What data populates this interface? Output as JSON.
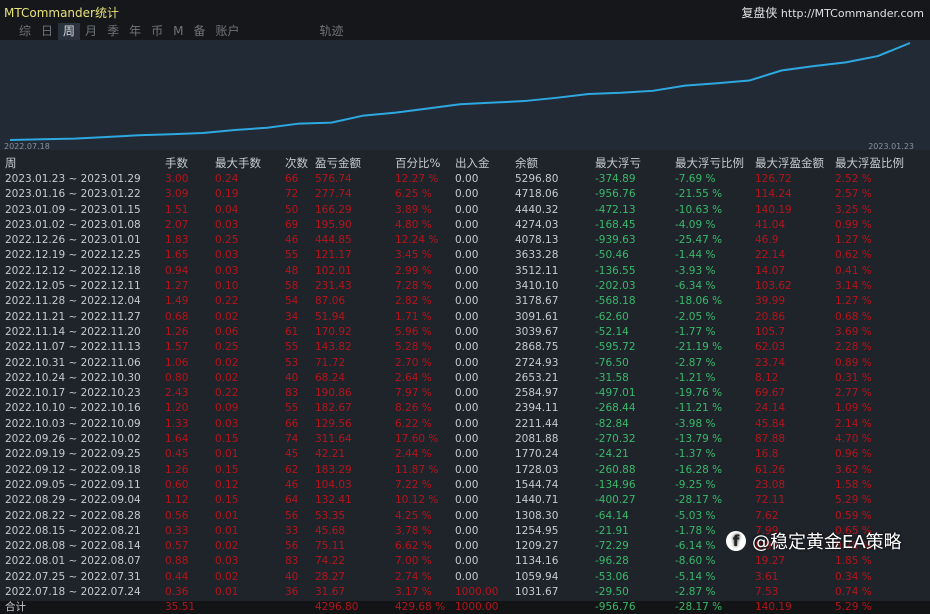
{
  "app": {
    "title": "MTCommander统计",
    "site_name": "复盘侠",
    "site_url": "http://MTCommander.com"
  },
  "tabs": [
    "综",
    "日",
    "周",
    "月",
    "季",
    "年",
    "币",
    "M",
    "备",
    "账户",
    "轨迹"
  ],
  "active_tab": "周",
  "chart": {
    "start_label": "2022.07.18",
    "end_label": "2023.01.23",
    "line_color": "#2ea8e0"
  },
  "columns": [
    "周",
    "手数",
    "最大手数",
    "次数",
    "盈亏金额",
    "百分比%",
    "出入金",
    "余额",
    "最大浮亏",
    "最大浮亏比例",
    "最大浮盈金额",
    "最大浮盈比例"
  ],
  "rows": [
    [
      "2023.01.23 ~ 2023.01.29",
      "3.00",
      "0.24",
      "66",
      "576.74",
      "12.27 %",
      "0.00",
      "5296.80",
      "-374.89",
      "-7.69 %",
      "126.72",
      "2.52 %"
    ],
    [
      "2023.01.16 ~ 2023.01.22",
      "3.09",
      "0.19",
      "72",
      "277.74",
      "6.25 %",
      "0.00",
      "4718.06",
      "-956.76",
      "-21.55 %",
      "114.24",
      "2.57 %"
    ],
    [
      "2023.01.09 ~ 2023.01.15",
      "1.51",
      "0.04",
      "50",
      "166.29",
      "3.89 %",
      "0.00",
      "4440.32",
      "-472.13",
      "-10.63 %",
      "140.19",
      "3.25 %"
    ],
    [
      "2023.01.02 ~ 2023.01.08",
      "2.07",
      "0.03",
      "69",
      "195.90",
      "4.80 %",
      "0.00",
      "4274.03",
      "-168.45",
      "-4.09 %",
      "41.04",
      "0.99 %"
    ],
    [
      "2022.12.26 ~ 2023.01.01",
      "1.83",
      "0.25",
      "46",
      "444.85",
      "12.24 %",
      "0.00",
      "4078.13",
      "-939.63",
      "-25.47 %",
      "46.9",
      "1.27 %"
    ],
    [
      "2022.12.19 ~ 2022.12.25",
      "1.65",
      "0.03",
      "55",
      "121.17",
      "3.45 %",
      "0.00",
      "3633.28",
      "-50.46",
      "-1.44 %",
      "22.14",
      "0.62 %"
    ],
    [
      "2022.12.12 ~ 2022.12.18",
      "0.94",
      "0.03",
      "48",
      "102.01",
      "2.99 %",
      "0.00",
      "3512.11",
      "-136.55",
      "-3.93 %",
      "14.07",
      "0.41 %"
    ],
    [
      "2022.12.05 ~ 2022.12.11",
      "1.27",
      "0.10",
      "58",
      "231.43",
      "7.28 %",
      "0.00",
      "3410.10",
      "-202.03",
      "-6.34 %",
      "103.62",
      "3.14 %"
    ],
    [
      "2022.11.28 ~ 2022.12.04",
      "1.49",
      "0.22",
      "54",
      "87.06",
      "2.82 %",
      "0.00",
      "3178.67",
      "-568.18",
      "-18.06 %",
      "39.99",
      "1.27 %"
    ],
    [
      "2022.11.21 ~ 2022.11.27",
      "0.68",
      "0.02",
      "34",
      "51.94",
      "1.71 %",
      "0.00",
      "3091.61",
      "-62.60",
      "-2.05 %",
      "20.86",
      "0.68 %"
    ],
    [
      "2022.11.14 ~ 2022.11.20",
      "1.26",
      "0.06",
      "61",
      "170.92",
      "5.96 %",
      "0.00",
      "3039.67",
      "-52.14",
      "-1.77 %",
      "105.7",
      "3.69 %"
    ],
    [
      "2022.11.07 ~ 2022.11.13",
      "1.57",
      "0.25",
      "55",
      "143.82",
      "5.28 %",
      "0.00",
      "2868.75",
      "-595.72",
      "-21.19 %",
      "62.03",
      "2.28 %"
    ],
    [
      "2022.10.31 ~ 2022.11.06",
      "1.06",
      "0.02",
      "53",
      "71.72",
      "2.70 %",
      "0.00",
      "2724.93",
      "-76.50",
      "-2.87 %",
      "23.74",
      "0.89 %"
    ],
    [
      "2022.10.24 ~ 2022.10.30",
      "0.80",
      "0.02",
      "40",
      "68.24",
      "2.64 %",
      "0.00",
      "2653.21",
      "-31.58",
      "-1.21 %",
      "8.12",
      "0.31 %"
    ],
    [
      "2022.10.17 ~ 2022.10.23",
      "2.43",
      "0.22",
      "83",
      "190.86",
      "7.97 %",
      "0.00",
      "2584.97",
      "-497.01",
      "-19.76 %",
      "69.67",
      "2.77 %"
    ],
    [
      "2022.10.10 ~ 2022.10.16",
      "1.20",
      "0.09",
      "55",
      "182.67",
      "8.26 %",
      "0.00",
      "2394.11",
      "-268.44",
      "-11.21 %",
      "24.14",
      "1.09 %"
    ],
    [
      "2022.10.03 ~ 2022.10.09",
      "1.33",
      "0.03",
      "66",
      "129.56",
      "6.22 %",
      "0.00",
      "2211.44",
      "-82.84",
      "-3.98 %",
      "45.84",
      "2.14 %"
    ],
    [
      "2022.09.26 ~ 2022.10.02",
      "1.64",
      "0.15",
      "74",
      "311.64",
      "17.60 %",
      "0.00",
      "2081.88",
      "-270.32",
      "-13.79 %",
      "87.88",
      "4.70 %"
    ],
    [
      "2022.09.19 ~ 2022.09.25",
      "0.45",
      "0.01",
      "45",
      "42.21",
      "2.44 %",
      "0.00",
      "1770.24",
      "-24.21",
      "-1.37 %",
      "16.8",
      "0.96 %"
    ],
    [
      "2022.09.12 ~ 2022.09.18",
      "1.26",
      "0.15",
      "62",
      "183.29",
      "11.87 %",
      "0.00",
      "1728.03",
      "-260.88",
      "-16.28 %",
      "61.26",
      "3.62 %"
    ],
    [
      "2022.09.05 ~ 2022.09.11",
      "0.60",
      "0.12",
      "46",
      "104.03",
      "7.22 %",
      "0.00",
      "1544.74",
      "-134.96",
      "-9.25 %",
      "23.08",
      "1.58 %"
    ],
    [
      "2022.08.29 ~ 2022.09.04",
      "1.12",
      "0.15",
      "64",
      "132.41",
      "10.12 %",
      "0.00",
      "1440.71",
      "-400.27",
      "-28.17 %",
      "72.11",
      "5.29 %"
    ],
    [
      "2022.08.22 ~ 2022.08.28",
      "0.56",
      "0.01",
      "56",
      "53.35",
      "4.25 %",
      "0.00",
      "1308.30",
      "-64.14",
      "-5.03 %",
      "7.62",
      "0.59 %"
    ],
    [
      "2022.08.15 ~ 2022.08.21",
      "0.33",
      "0.01",
      "33",
      "45.68",
      "3.78 %",
      "0.00",
      "1254.95",
      "-21.91",
      "-1.78 %",
      "7.99",
      "0.65 %"
    ],
    [
      "2022.08.08 ~ 2022.08.14",
      "0.57",
      "0.02",
      "56",
      "75.11",
      "6.62 %",
      "0.00",
      "1209.27",
      "-72.29",
      "-6.14 %",
      "8.95",
      "0.78 %"
    ],
    [
      "2022.08.01 ~ 2022.08.07",
      "0.88",
      "0.03",
      "83",
      "74.22",
      "7.00 %",
      "0.00",
      "1134.16",
      "-96.28",
      "-8.60 %",
      "19.27",
      "1.85 %"
    ],
    [
      "2022.07.25 ~ 2022.07.31",
      "0.44",
      "0.02",
      "40",
      "28.27",
      "2.74 %",
      "0.00",
      "1059.94",
      "-53.06",
      "-5.14 %",
      "3.61",
      "0.34 %"
    ],
    [
      "2022.07.18 ~ 2022.07.24",
      "0.36",
      "0.01",
      "36",
      "31.67",
      "3.17 %",
      "1000.00",
      "1031.67",
      "-29.50",
      "-2.87 %",
      "7.53",
      "0.74 %"
    ]
  ],
  "total": [
    "合计",
    "35.51",
    "",
    "",
    "4296.80",
    "429.68 %",
    "1000.00",
    "",
    "-956.76",
    "-28.17 %",
    "140.19",
    "5.29 %"
  ],
  "watermark": "@稳定黄金EA策略"
}
